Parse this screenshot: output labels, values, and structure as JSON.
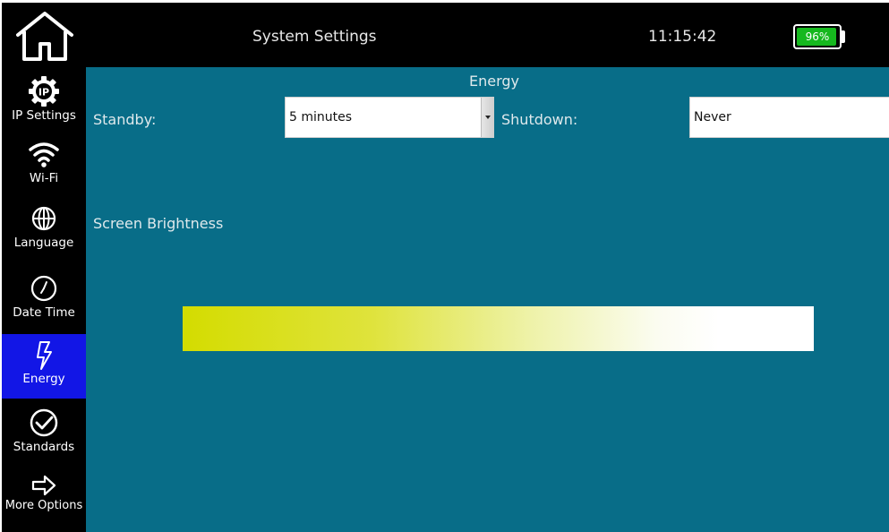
{
  "header": {
    "title": "System Settings",
    "time": "11:15:42",
    "battery": {
      "percent_label": "96%",
      "level": 0.96,
      "color": "#16b81e"
    }
  },
  "sidebar": {
    "items": [
      {
        "label": "IP Settings",
        "icon": "ip-gear-icon",
        "active": false
      },
      {
        "label": "Wi-Fi",
        "icon": "wifi-icon",
        "active": false
      },
      {
        "label": "Language",
        "icon": "globe-icon",
        "active": false
      },
      {
        "label": "Date Time",
        "icon": "clock-icon",
        "active": false
      },
      {
        "label": "Energy",
        "icon": "lightning-icon",
        "active": true
      },
      {
        "label": "Standards",
        "icon": "check-circle-icon",
        "active": false
      },
      {
        "label": "More Options",
        "icon": "arrow-right-icon",
        "active": false
      }
    ],
    "active_color": "#1216e6"
  },
  "content": {
    "section_title": "Energy",
    "standby": {
      "label": "Standby:",
      "value": "5 minutes"
    },
    "shutdown": {
      "label": "Shutdown:",
      "value": "Never"
    },
    "brightness": {
      "label": "Screen Brightness"
    },
    "background_color": "#086d88"
  }
}
